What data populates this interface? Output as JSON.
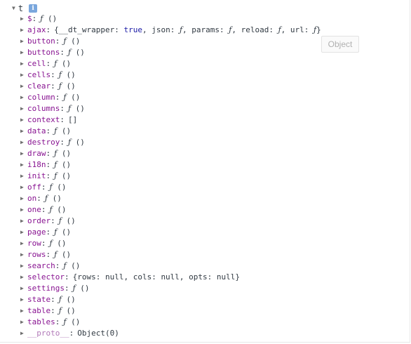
{
  "root": {
    "label": "t",
    "info_badge": "i"
  },
  "tooltip": "Object",
  "properties": [
    {
      "key": "$",
      "value": "ƒ ()"
    },
    {
      "key": "ajax",
      "value": "{__dt_wrapper: true, json: ƒ, params: ƒ, reload: ƒ, url: ƒ}"
    },
    {
      "key": "button",
      "value": "ƒ ()"
    },
    {
      "key": "buttons",
      "value": "ƒ ()"
    },
    {
      "key": "cell",
      "value": "ƒ ()"
    },
    {
      "key": "cells",
      "value": "ƒ ()"
    },
    {
      "key": "clear",
      "value": "ƒ ()"
    },
    {
      "key": "column",
      "value": "ƒ ()"
    },
    {
      "key": "columns",
      "value": "ƒ ()"
    },
    {
      "key": "context",
      "value": "[]"
    },
    {
      "key": "data",
      "value": "ƒ ()"
    },
    {
      "key": "destroy",
      "value": "ƒ ()"
    },
    {
      "key": "draw",
      "value": "ƒ ()"
    },
    {
      "key": "i18n",
      "value": "ƒ ()"
    },
    {
      "key": "init",
      "value": "ƒ ()"
    },
    {
      "key": "off",
      "value": "ƒ ()"
    },
    {
      "key": "on",
      "value": "ƒ ()"
    },
    {
      "key": "one",
      "value": "ƒ ()"
    },
    {
      "key": "order",
      "value": "ƒ ()"
    },
    {
      "key": "page",
      "value": "ƒ ()"
    },
    {
      "key": "row",
      "value": "ƒ ()"
    },
    {
      "key": "rows",
      "value": "ƒ ()"
    },
    {
      "key": "search",
      "value": "ƒ ()"
    },
    {
      "key": "selector",
      "value": "{rows: null, cols: null, opts: null}"
    },
    {
      "key": "settings",
      "value": "ƒ ()"
    },
    {
      "key": "state",
      "value": "ƒ ()"
    },
    {
      "key": "table",
      "value": "ƒ ()"
    },
    {
      "key": "tables",
      "value": "ƒ ()"
    },
    {
      "key": "__proto__",
      "value": "Object(0)"
    }
  ]
}
